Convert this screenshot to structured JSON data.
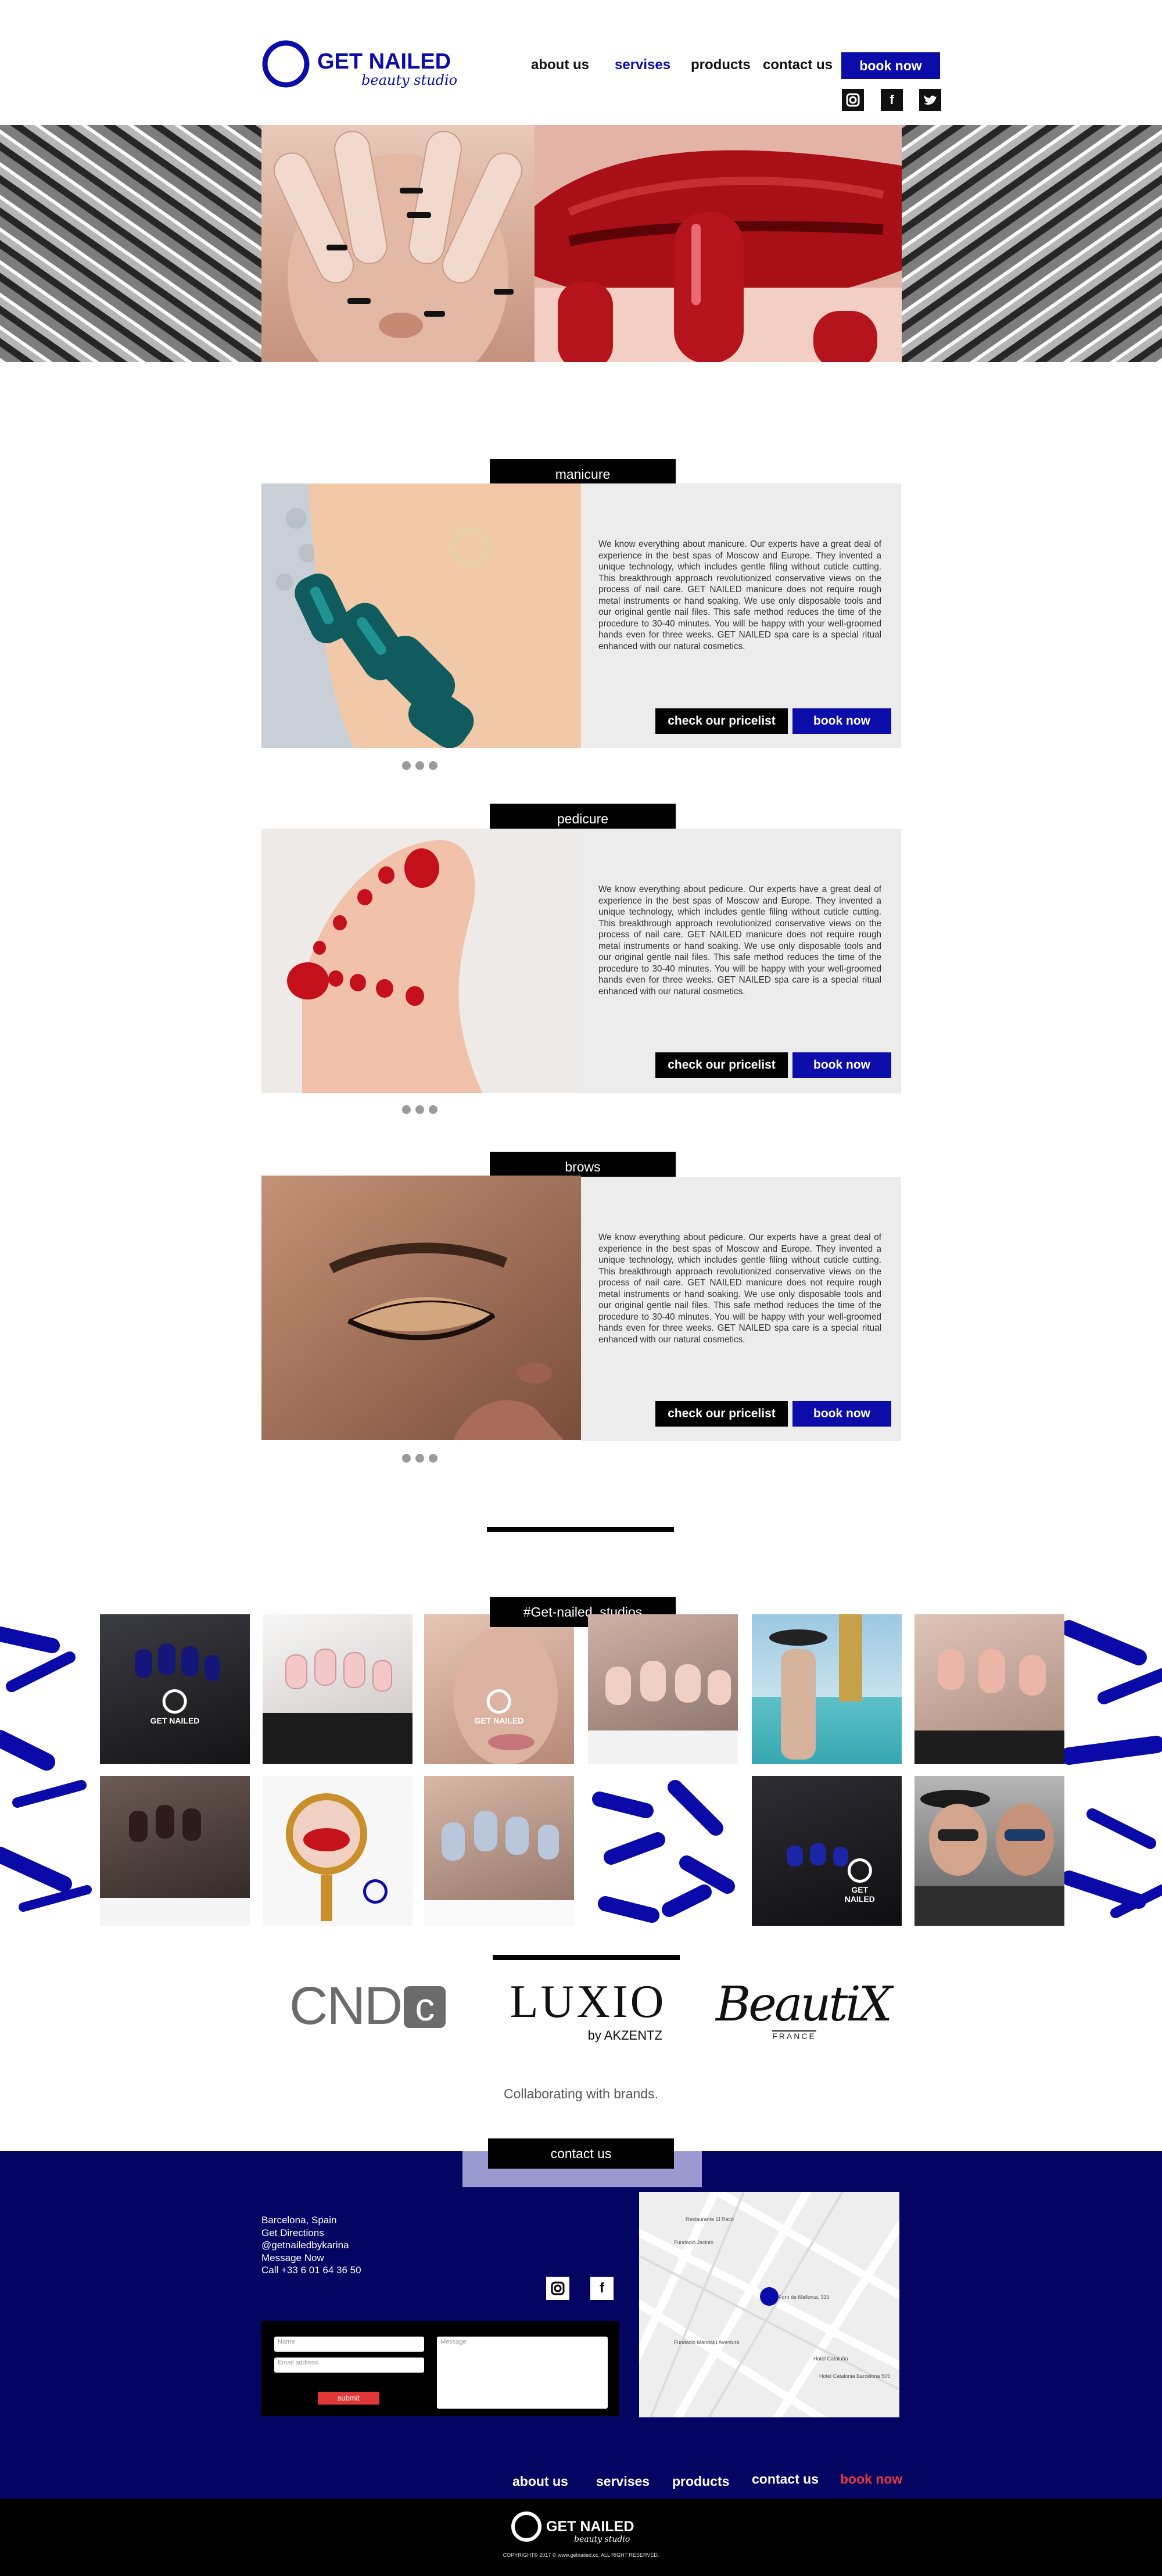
{
  "brand": {
    "name": "GET NAILED",
    "tagline": "beauty studio",
    "accent": "#0c0caa",
    "dark_blue": "#040462"
  },
  "header": {
    "nav": [
      "about us",
      "servises",
      "products",
      "contact us"
    ],
    "active": "servises",
    "book_label": "book now",
    "social": [
      {
        "icon": "instagram-icon",
        "glyph": "◎"
      },
      {
        "icon": "facebook-icon",
        "glyph": "f"
      },
      {
        "icon": "twitter-icon",
        "glyph": "✦"
      }
    ]
  },
  "services": [
    {
      "title": "manicure",
      "text": "We know everything about manicure. Our experts have a great deal of experience in the best spas of Moscow and Europe. They invented a unique technology, which includes gentle filing without cuticle cutting. This breakthrough approach revolutionized conservative views on the process of nail care. GET NAILED manicure does not require rough metal instruments or hand soaking. We use only disposable tools and our original gentle nail files. This safe method reduces the time of the procedure to 30-40 minutes. You will be happy with your well-groomed hands even for three weeks. GET NAILED spa care is a special ritual enhanced with our natural cosmetics.",
      "pricelist_label": "check our pricelist",
      "book_label": "book now"
    },
    {
      "title": "pedicure",
      "text": "We know everything about pedicure. Our experts have a great deal of experience in the best spas of Moscow and Europe. They invented a unique technology, which includes gentle filing without cuticle cutting. This breakthrough approach revolutionized conservative views on the process of nail care. GET NAILED manicure does not require rough metal instruments or hand soaking. We use only disposable tools and our original gentle nail files. This safe method reduces the time of the procedure to 30-40 minutes. You will be happy with your well-groomed hands even for three weeks. GET NAILED spa care is a special ritual enhanced with our natural cosmetics.",
      "pricelist_label": "check our pricelist",
      "book_label": "book now"
    },
    {
      "title": "brows",
      "text": "We know everything about pedicure. Our experts have a great deal of experience in the best spas of Moscow and Europe. They invented a unique technology, which includes gentle filing without cuticle cutting. This breakthrough approach revolutionized conservative views on the process of nail care. GET NAILED manicure does not require rough metal instruments or hand soaking. We use only disposable tools and our original gentle nail files. This safe method reduces the time of the procedure to 30-40 minutes. You will be happy with your well-groomed hands even for three weeks. GET NAILED spa care is a special ritual enhanced with our natural cosmetics.",
      "pricelist_label": "check our pricelist",
      "book_label": "book now"
    }
  ],
  "gallery": {
    "label": "#Get-nailed_studios",
    "watermark": "GET NAILED"
  },
  "brands": {
    "list": [
      "CND",
      "LUXIO",
      "by AKZENTZ",
      "BeautiX",
      "FRANCE"
    ],
    "caption": "Collaborating with  brands."
  },
  "contact": {
    "label": "contact us",
    "lines": [
      "Barcelona, Spain",
      "Get Directions",
      "@getnailedbykarina",
      "Message Now",
      "Call +33 6 01 64 36 50"
    ],
    "form": {
      "name_placeholder": "Name",
      "email_placeholder": "Email address",
      "message_placeholder": "Message",
      "submit_label": "submit"
    },
    "map": {
      "labels": [
        "Restaurante El Racó",
        "Forn de Mallorca, 335",
        "Fundació Jacinto",
        "Fundació Mandatu Aventura",
        "Hotel Cataluña",
        "Hotel Catalonia Barcelona 505"
      ]
    }
  },
  "footer": {
    "nav": [
      "about us",
      "servises",
      "products",
      "contact us",
      "book now"
    ],
    "copyright": "COPYRIGHT© 2017 © www.getnailed.cc. ALL RIGHT RESERVED."
  }
}
